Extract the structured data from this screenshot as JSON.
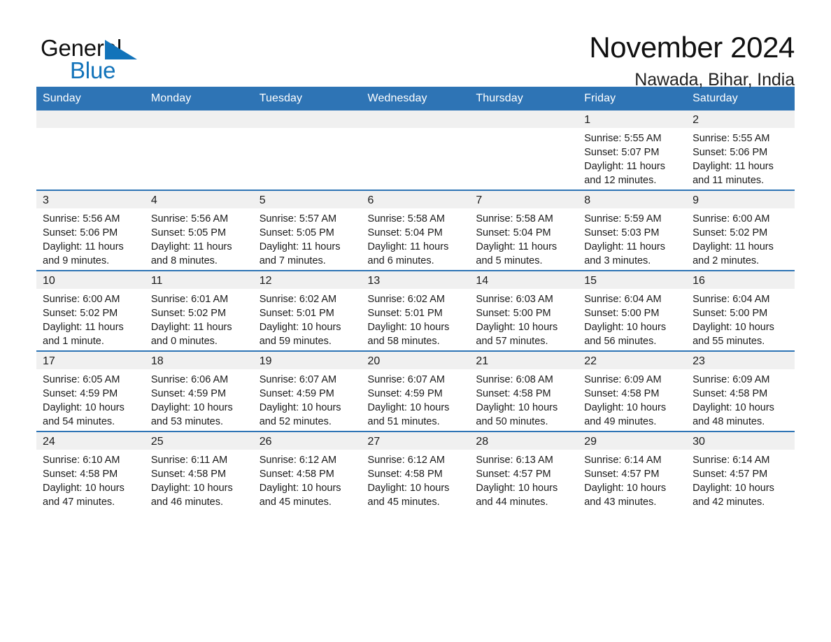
{
  "brand": {
    "name_part1": "General",
    "name_part2": "Blue",
    "logo_icon": "triangle-icon",
    "accent_color": "#1273ba"
  },
  "header": {
    "month_title": "November 2024",
    "location": "Nawada, Bihar, India"
  },
  "theme": {
    "header_blue": "#2e74b5",
    "daynum_band": "#f0f0f0",
    "text": "#1a1a1a"
  },
  "weekdays": [
    "Sunday",
    "Monday",
    "Tuesday",
    "Wednesday",
    "Thursday",
    "Friday",
    "Saturday"
  ],
  "weeks": [
    [
      {
        "day": "",
        "sunrise": "",
        "sunset": "",
        "daylight": "",
        "empty": true
      },
      {
        "day": "",
        "sunrise": "",
        "sunset": "",
        "daylight": "",
        "empty": true
      },
      {
        "day": "",
        "sunrise": "",
        "sunset": "",
        "daylight": "",
        "empty": true
      },
      {
        "day": "",
        "sunrise": "",
        "sunset": "",
        "daylight": "",
        "empty": true
      },
      {
        "day": "",
        "sunrise": "",
        "sunset": "",
        "daylight": "",
        "empty": true
      },
      {
        "day": "1",
        "sunrise": "Sunrise: 5:55 AM",
        "sunset": "Sunset: 5:07 PM",
        "daylight": "Daylight: 11 hours and 12 minutes."
      },
      {
        "day": "2",
        "sunrise": "Sunrise: 5:55 AM",
        "sunset": "Sunset: 5:06 PM",
        "daylight": "Daylight: 11 hours and 11 minutes."
      }
    ],
    [
      {
        "day": "3",
        "sunrise": "Sunrise: 5:56 AM",
        "sunset": "Sunset: 5:06 PM",
        "daylight": "Daylight: 11 hours and 9 minutes."
      },
      {
        "day": "4",
        "sunrise": "Sunrise: 5:56 AM",
        "sunset": "Sunset: 5:05 PM",
        "daylight": "Daylight: 11 hours and 8 minutes."
      },
      {
        "day": "5",
        "sunrise": "Sunrise: 5:57 AM",
        "sunset": "Sunset: 5:05 PM",
        "daylight": "Daylight: 11 hours and 7 minutes."
      },
      {
        "day": "6",
        "sunrise": "Sunrise: 5:58 AM",
        "sunset": "Sunset: 5:04 PM",
        "daylight": "Daylight: 11 hours and 6 minutes."
      },
      {
        "day": "7",
        "sunrise": "Sunrise: 5:58 AM",
        "sunset": "Sunset: 5:04 PM",
        "daylight": "Daylight: 11 hours and 5 minutes."
      },
      {
        "day": "8",
        "sunrise": "Sunrise: 5:59 AM",
        "sunset": "Sunset: 5:03 PM",
        "daylight": "Daylight: 11 hours and 3 minutes."
      },
      {
        "day": "9",
        "sunrise": "Sunrise: 6:00 AM",
        "sunset": "Sunset: 5:02 PM",
        "daylight": "Daylight: 11 hours and 2 minutes."
      }
    ],
    [
      {
        "day": "10",
        "sunrise": "Sunrise: 6:00 AM",
        "sunset": "Sunset: 5:02 PM",
        "daylight": "Daylight: 11 hours and 1 minute."
      },
      {
        "day": "11",
        "sunrise": "Sunrise: 6:01 AM",
        "sunset": "Sunset: 5:02 PM",
        "daylight": "Daylight: 11 hours and 0 minutes."
      },
      {
        "day": "12",
        "sunrise": "Sunrise: 6:02 AM",
        "sunset": "Sunset: 5:01 PM",
        "daylight": "Daylight: 10 hours and 59 minutes."
      },
      {
        "day": "13",
        "sunrise": "Sunrise: 6:02 AM",
        "sunset": "Sunset: 5:01 PM",
        "daylight": "Daylight: 10 hours and 58 minutes."
      },
      {
        "day": "14",
        "sunrise": "Sunrise: 6:03 AM",
        "sunset": "Sunset: 5:00 PM",
        "daylight": "Daylight: 10 hours and 57 minutes."
      },
      {
        "day": "15",
        "sunrise": "Sunrise: 6:04 AM",
        "sunset": "Sunset: 5:00 PM",
        "daylight": "Daylight: 10 hours and 56 minutes."
      },
      {
        "day": "16",
        "sunrise": "Sunrise: 6:04 AM",
        "sunset": "Sunset: 5:00 PM",
        "daylight": "Daylight: 10 hours and 55 minutes."
      }
    ],
    [
      {
        "day": "17",
        "sunrise": "Sunrise: 6:05 AM",
        "sunset": "Sunset: 4:59 PM",
        "daylight": "Daylight: 10 hours and 54 minutes."
      },
      {
        "day": "18",
        "sunrise": "Sunrise: 6:06 AM",
        "sunset": "Sunset: 4:59 PM",
        "daylight": "Daylight: 10 hours and 53 minutes."
      },
      {
        "day": "19",
        "sunrise": "Sunrise: 6:07 AM",
        "sunset": "Sunset: 4:59 PM",
        "daylight": "Daylight: 10 hours and 52 minutes."
      },
      {
        "day": "20",
        "sunrise": "Sunrise: 6:07 AM",
        "sunset": "Sunset: 4:59 PM",
        "daylight": "Daylight: 10 hours and 51 minutes."
      },
      {
        "day": "21",
        "sunrise": "Sunrise: 6:08 AM",
        "sunset": "Sunset: 4:58 PM",
        "daylight": "Daylight: 10 hours and 50 minutes."
      },
      {
        "day": "22",
        "sunrise": "Sunrise: 6:09 AM",
        "sunset": "Sunset: 4:58 PM",
        "daylight": "Daylight: 10 hours and 49 minutes."
      },
      {
        "day": "23",
        "sunrise": "Sunrise: 6:09 AM",
        "sunset": "Sunset: 4:58 PM",
        "daylight": "Daylight: 10 hours and 48 minutes."
      }
    ],
    [
      {
        "day": "24",
        "sunrise": "Sunrise: 6:10 AM",
        "sunset": "Sunset: 4:58 PM",
        "daylight": "Daylight: 10 hours and 47 minutes."
      },
      {
        "day": "25",
        "sunrise": "Sunrise: 6:11 AM",
        "sunset": "Sunset: 4:58 PM",
        "daylight": "Daylight: 10 hours and 46 minutes."
      },
      {
        "day": "26",
        "sunrise": "Sunrise: 6:12 AM",
        "sunset": "Sunset: 4:58 PM",
        "daylight": "Daylight: 10 hours and 45 minutes."
      },
      {
        "day": "27",
        "sunrise": "Sunrise: 6:12 AM",
        "sunset": "Sunset: 4:58 PM",
        "daylight": "Daylight: 10 hours and 45 minutes."
      },
      {
        "day": "28",
        "sunrise": "Sunrise: 6:13 AM",
        "sunset": "Sunset: 4:57 PM",
        "daylight": "Daylight: 10 hours and 44 minutes."
      },
      {
        "day": "29",
        "sunrise": "Sunrise: 6:14 AM",
        "sunset": "Sunset: 4:57 PM",
        "daylight": "Daylight: 10 hours and 43 minutes."
      },
      {
        "day": "30",
        "sunrise": "Sunrise: 6:14 AM",
        "sunset": "Sunset: 4:57 PM",
        "daylight": "Daylight: 10 hours and 42 minutes."
      }
    ]
  ]
}
